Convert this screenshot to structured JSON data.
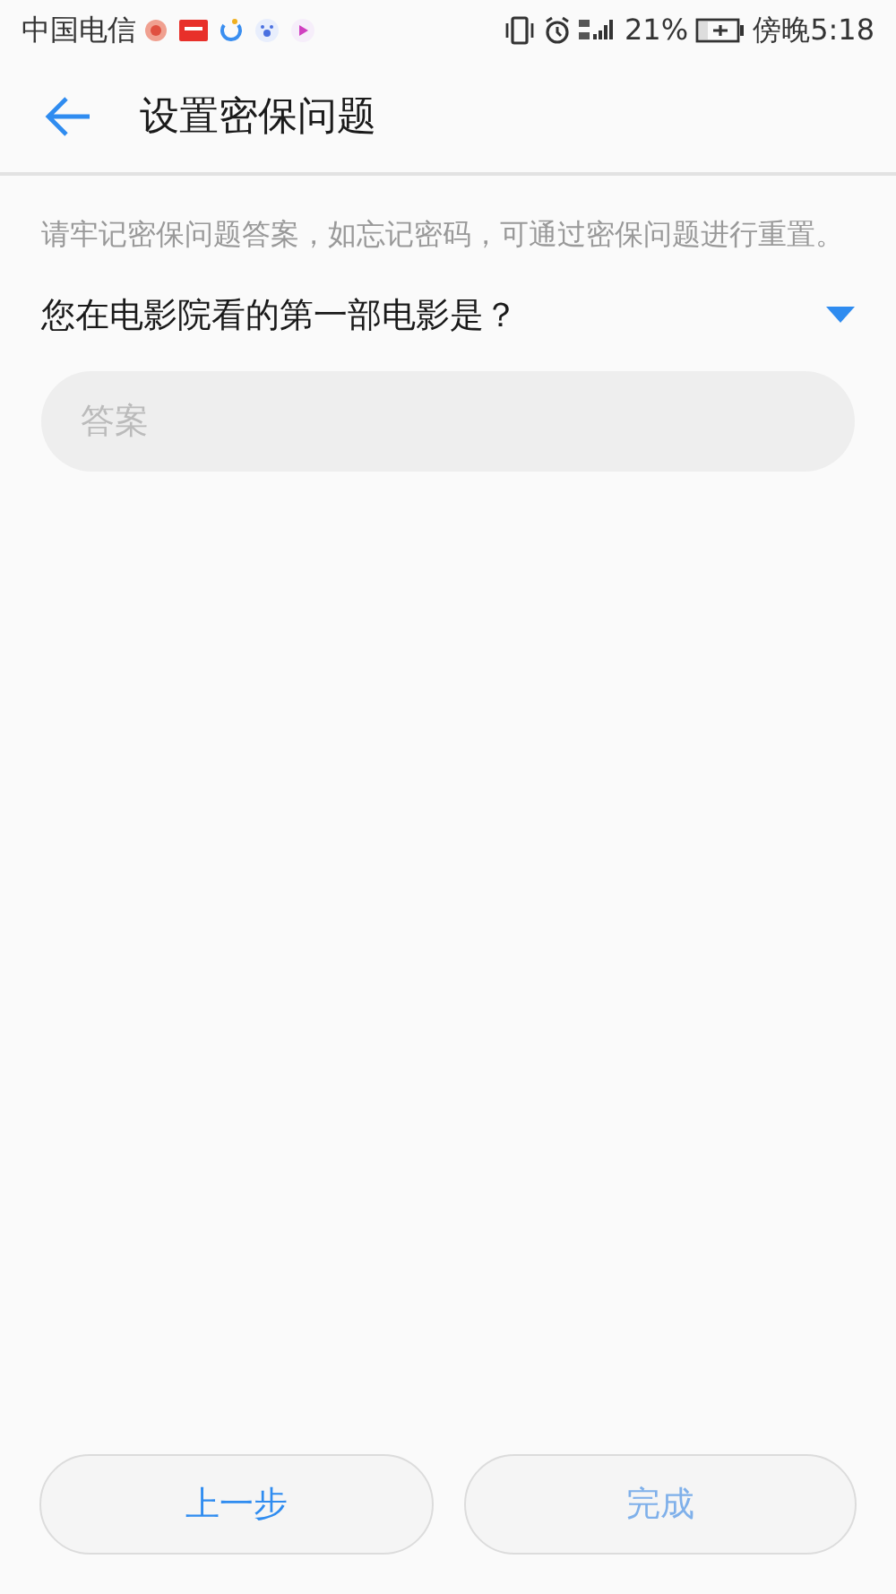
{
  "status_bar": {
    "carrier": "中国电信",
    "battery_percent": "21%",
    "time": "傍晚5:18"
  },
  "header": {
    "title": "设置密保问题"
  },
  "hint": "请牢记密保问题答案，如忘记密码，可通过密保问题进行重置。",
  "question": {
    "text": "您在电影院看的第一部电影是？"
  },
  "answer": {
    "placeholder": "答案"
  },
  "buttons": [
    {
      "label": "上一步",
      "disabled": false
    },
    {
      "label": "完成",
      "disabled": true
    }
  ]
}
